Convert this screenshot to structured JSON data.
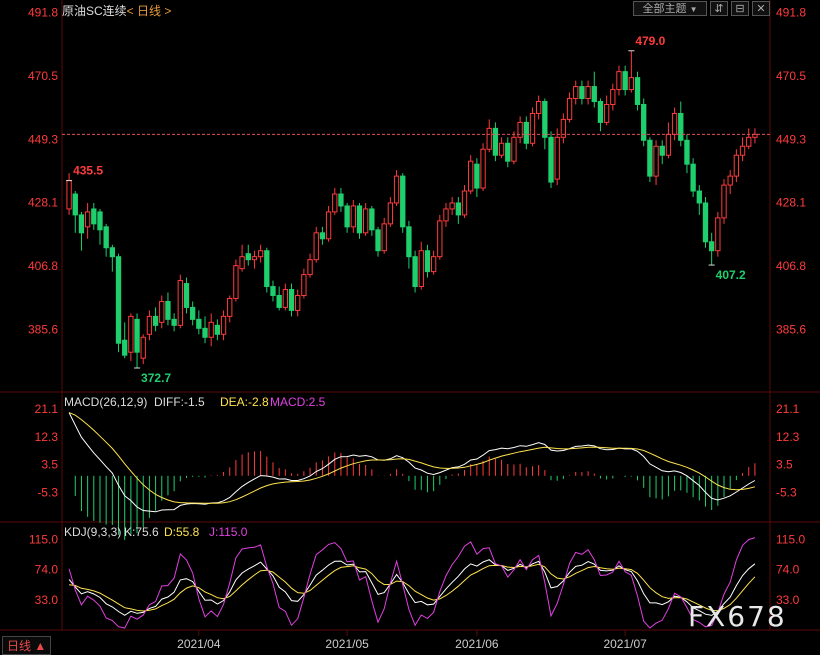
{
  "header": {
    "title": "原油SC连续",
    "period_link": "< 日线 >",
    "theme_button": "全部主题",
    "dropdown_icon": "triangle-down-icon",
    "btn2": "⇵",
    "btn3": "⊟",
    "close_icon": "✕"
  },
  "footer": {
    "period": "日线 ▲",
    "watermark": "FX678"
  },
  "colors": {
    "up": "#ff3b3b",
    "down": "#1fcf6e",
    "diff": "#ffffff",
    "dea": "#ffe34d",
    "j": "#e040e0",
    "axis": "#7a1010"
  },
  "chart_data": [
    {
      "type": "candlestick",
      "title": "原油SC连续",
      "y_ticks": [
        "491.8",
        "470.5",
        "449.3",
        "428.1",
        "406.8",
        "385.6"
      ],
      "ylim": [
        366,
        494
      ],
      "last_price": 451.0,
      "annotations": [
        {
          "label": "479.0",
          "value": 479.0,
          "kind": "high"
        },
        {
          "label": "435.5",
          "value": 435.5,
          "kind": "high"
        },
        {
          "label": "372.7",
          "value": 372.7,
          "kind": "low"
        },
        {
          "label": "407.2",
          "value": 407.2,
          "kind": "low"
        }
      ],
      "x_labels": [
        "2021/04",
        "2021/05",
        "2021/06",
        "2021/07"
      ],
      "x_label_index": [
        21,
        45,
        66,
        90
      ],
      "candles": [
        [
          426,
          435.5,
          438,
          424
        ],
        [
          431,
          424,
          432,
          418
        ],
        [
          424,
          418,
          425,
          412
        ],
        [
          420,
          425,
          428,
          416
        ],
        [
          426,
          421,
          428,
          419
        ],
        [
          425,
          419,
          426,
          414
        ],
        [
          420,
          413,
          421,
          410
        ],
        [
          413,
          410,
          414,
          405
        ],
        [
          410,
          381,
          411,
          378
        ],
        [
          382,
          377,
          388,
          376
        ],
        [
          378,
          390,
          391,
          375
        ],
        [
          389,
          378,
          391,
          372.7
        ],
        [
          376,
          383,
          384,
          374
        ],
        [
          384,
          390,
          392,
          382
        ],
        [
          390,
          387,
          393,
          385
        ],
        [
          388,
          395,
          397,
          386
        ],
        [
          395,
          389,
          398,
          387
        ],
        [
          389,
          387,
          391,
          385
        ],
        [
          387,
          402,
          404,
          386
        ],
        [
          401,
          393,
          403,
          391
        ],
        [
          393,
          389,
          395,
          387
        ],
        [
          389,
          386,
          392,
          384
        ],
        [
          386,
          383,
          390,
          381
        ],
        [
          383,
          388,
          391,
          380
        ],
        [
          387,
          384,
          389,
          382
        ],
        [
          384,
          390,
          392,
          382
        ],
        [
          390,
          396,
          397,
          388
        ],
        [
          396,
          407,
          409,
          395
        ],
        [
          406,
          410,
          414,
          405
        ],
        [
          411,
          409,
          414,
          407
        ],
        [
          409,
          410,
          412,
          406
        ],
        [
          410,
          412,
          414,
          408
        ],
        [
          412,
          400,
          413,
          398
        ],
        [
          400,
          397,
          402,
          395
        ],
        [
          397,
          393,
          400,
          392
        ],
        [
          393,
          399,
          401,
          392
        ],
        [
          399,
          392,
          401,
          390
        ],
        [
          392,
          397,
          399,
          390
        ],
        [
          397,
          404,
          406,
          396
        ],
        [
          404,
          409,
          411,
          403
        ],
        [
          409,
          418,
          420,
          408
        ],
        [
          418,
          416,
          420,
          414
        ],
        [
          416,
          425,
          427,
          415
        ],
        [
          425,
          431,
          433,
          424
        ],
        [
          431,
          427,
          433,
          425
        ],
        [
          427,
          420,
          428,
          418
        ],
        [
          420,
          427,
          429,
          418
        ],
        [
          427,
          418,
          428,
          416
        ],
        [
          418,
          426,
          428,
          417
        ],
        [
          426,
          419,
          427,
          417
        ],
        [
          419,
          412,
          420,
          410
        ],
        [
          412,
          421,
          423,
          411
        ],
        [
          421,
          428,
          430,
          420
        ],
        [
          428,
          437,
          439,
          427
        ],
        [
          437,
          420,
          438,
          418
        ],
        [
          420,
          410,
          422,
          406
        ],
        [
          410,
          400,
          412,
          398
        ],
        [
          400,
          412,
          415,
          399
        ],
        [
          412,
          405,
          414,
          403
        ],
        [
          405,
          410,
          412,
          404
        ],
        [
          410,
          422,
          424,
          409
        ],
        [
          422,
          426,
          428,
          420
        ],
        [
          426,
          428,
          430,
          424
        ],
        [
          428,
          424,
          430,
          421
        ],
        [
          424,
          432,
          434,
          423
        ],
        [
          432,
          442,
          444,
          431
        ],
        [
          441,
          433,
          443,
          430
        ],
        [
          433,
          446,
          448,
          432
        ],
        [
          446,
          453,
          456,
          445
        ],
        [
          453,
          444,
          455,
          442
        ],
        [
          444,
          448,
          450,
          443
        ],
        [
          448,
          442,
          450,
          440
        ],
        [
          442,
          450,
          452,
          441
        ],
        [
          450,
          455,
          457,
          448
        ],
        [
          455,
          448,
          457,
          446
        ],
        [
          448,
          458,
          460,
          447
        ],
        [
          458,
          462,
          464,
          456
        ],
        [
          462,
          450,
          463,
          446
        ],
        [
          450,
          435,
          452,
          433
        ],
        [
          436,
          450,
          453,
          434
        ],
        [
          450,
          456,
          458,
          448
        ],
        [
          456,
          463,
          465,
          455
        ],
        [
          463,
          467,
          469,
          461
        ],
        [
          467,
          463,
          469,
          461
        ],
        [
          463,
          467,
          469,
          461
        ],
        [
          467,
          462,
          472,
          460
        ],
        [
          462,
          455,
          463,
          452
        ],
        [
          455,
          461,
          464,
          454
        ],
        [
          461,
          466,
          468,
          459
        ],
        [
          466,
          472,
          474,
          464
        ],
        [
          472,
          466,
          474,
          464
        ],
        [
          466,
          470,
          479,
          465
        ],
        [
          470,
          461,
          472,
          459
        ],
        [
          461,
          449,
          463,
          447
        ],
        [
          449,
          437,
          450,
          435
        ],
        [
          437,
          447,
          449,
          434
        ],
        [
          447,
          444,
          449,
          441
        ],
        [
          444,
          451,
          455,
          443
        ],
        [
          451,
          458,
          460,
          449
        ],
        [
          458,
          449,
          462,
          447
        ],
        [
          449,
          441,
          451,
          438
        ],
        [
          441,
          432,
          443,
          430
        ],
        [
          432,
          428,
          434,
          424
        ],
        [
          428,
          415,
          430,
          413
        ],
        [
          415,
          412,
          418,
          407.2
        ],
        [
          412,
          423,
          425,
          410
        ],
        [
          423,
          434,
          436,
          421
        ],
        [
          434,
          437,
          439,
          431
        ],
        [
          437,
          444,
          446,
          435
        ],
        [
          444,
          447,
          450,
          442
        ],
        [
          447,
          450,
          453,
          446
        ],
        [
          450,
          451,
          453,
          448
        ]
      ]
    },
    {
      "type": "line",
      "title": "MACD(26,12,9)",
      "readout": {
        "diff": "DIFF:-1.5",
        "dea": "DEA:-2.8",
        "macd": "MACD:2.5"
      },
      "y_ticks": [
        "21.1",
        "12.3",
        "3.5",
        "-5.3"
      ],
      "ylim": [
        -14,
        24
      ]
    },
    {
      "type": "line",
      "title": "KDJ(9,3,3)",
      "readout": {
        "k": "K:75.6",
        "d": "D:55.8",
        "j": "J:115.0"
      },
      "y_ticks": [
        "115.0",
        "74.0",
        "33.0"
      ],
      "ylim": [
        -5,
        125
      ]
    }
  ]
}
